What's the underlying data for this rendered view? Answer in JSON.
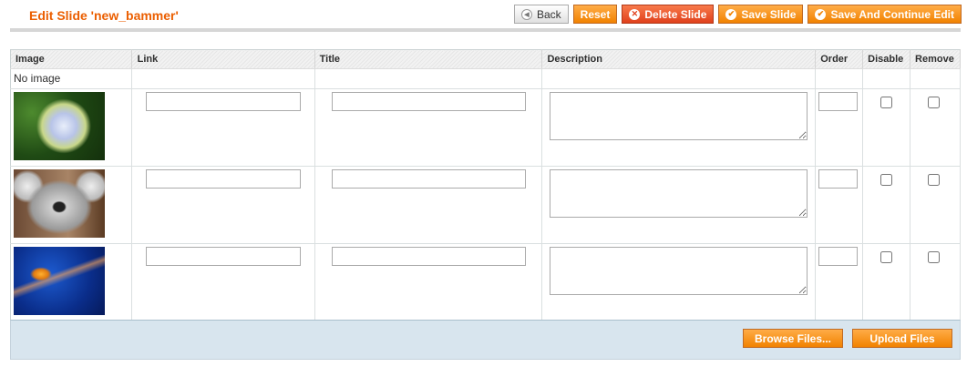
{
  "page_title": "Edit Slide 'new_bammer'",
  "buttons": {
    "back": "Back",
    "reset": "Reset",
    "delete": "Delete Slide",
    "save": "Save Slide",
    "save_continue": "Save And Continue Edit"
  },
  "columns": [
    "Image",
    "Link",
    "Title",
    "Description",
    "Order",
    "Disable",
    "Remove"
  ],
  "no_image": "No image",
  "rows": [
    {
      "image": "hydrangea flower"
    },
    {
      "image": "koala"
    },
    {
      "image": "jellyfish"
    }
  ],
  "footer": {
    "browse": "Browse Files...",
    "upload": "Upload Files"
  }
}
